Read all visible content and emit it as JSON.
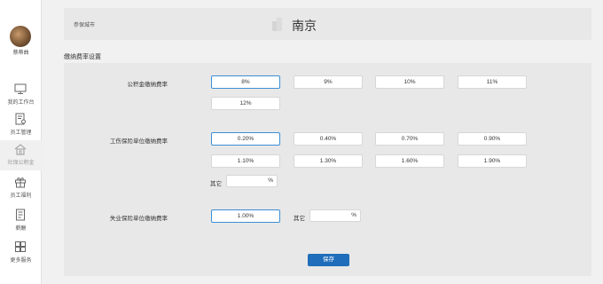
{
  "user": {
    "name": "蔡蒂曲"
  },
  "nav": {
    "items": [
      {
        "label": "我的工作台",
        "icon": "monitor-icon"
      },
      {
        "label": "员工管理",
        "icon": "employee-doc-icon"
      },
      {
        "label": "社保公积金",
        "icon": "house-icon"
      },
      {
        "label": "员工福利",
        "icon": "gift-icon"
      },
      {
        "label": "薪酬",
        "icon": "salary-doc-icon"
      },
      {
        "label": "更多服务",
        "icon": "grid-icon"
      }
    ],
    "active_index": 2
  },
  "city": {
    "label": "参保城市",
    "name": "南京",
    "icon": "building-icon"
  },
  "section_title": "缴纳费率设置",
  "housing_fund": {
    "label": "公积金缴纳费率",
    "options": [
      "8%",
      "9%",
      "10%",
      "11%",
      "12%"
    ],
    "selected": "8%"
  },
  "injury_insurance": {
    "label": "工伤保险单位缴纳费率",
    "options": [
      "0.20%",
      "0.40%",
      "0.70%",
      "0.90%",
      "1.10%",
      "1.30%",
      "1.60%",
      "1.90%"
    ],
    "selected": "0.20%",
    "other_label": "其它",
    "other_value": "",
    "other_unit": "%"
  },
  "unemployment_insurance": {
    "label": "失业保险单位缴纳费率",
    "options": [
      "1.00%"
    ],
    "selected": "1.00%",
    "other_label": "其它",
    "other_value": "",
    "other_unit": "%"
  },
  "save_label": "保存",
  "colors": {
    "accent": "#3c8fd6",
    "button": "#1f6dbb"
  }
}
